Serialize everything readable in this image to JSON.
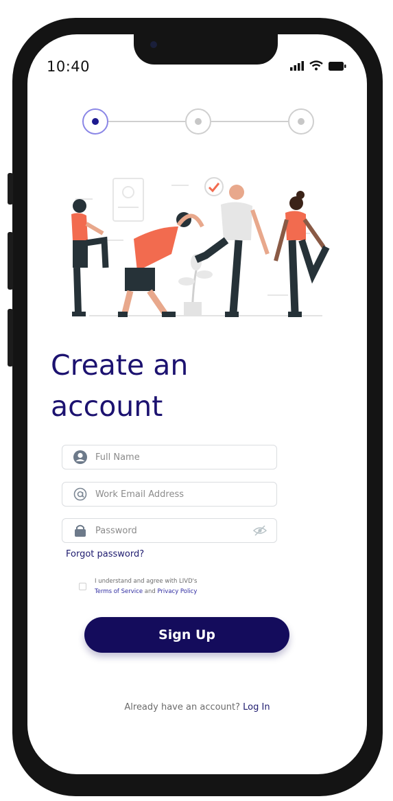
{
  "status_bar": {
    "time": "10:40"
  },
  "stepper": {
    "steps": [
      "step-1",
      "step-2",
      "step-3"
    ],
    "current_step": 1
  },
  "form": {
    "title_line1": "Create an",
    "title_line2": "account",
    "full_name_placeholder": "Full Name",
    "email_placeholder": "Work Email Address",
    "password_placeholder": "Password",
    "forgot_password": "Forgot password?",
    "agree_prefix": "I understand and agree with LIVD's",
    "terms_link": "Terms of Service",
    "agree_and": " and ",
    "privacy_link": "Privacy Policy",
    "signup_label": "Sign Up",
    "have_account": "Already have an account? ",
    "login_link": "Log In"
  },
  "colors": {
    "brand": "#140c5c",
    "accent": "#f26b4f",
    "link": "#2d2aa0"
  },
  "icons": [
    "signal-icon",
    "wifi-icon",
    "battery-icon",
    "user-icon",
    "at-icon",
    "lock-icon",
    "eye-off-icon",
    "check-icon"
  ]
}
